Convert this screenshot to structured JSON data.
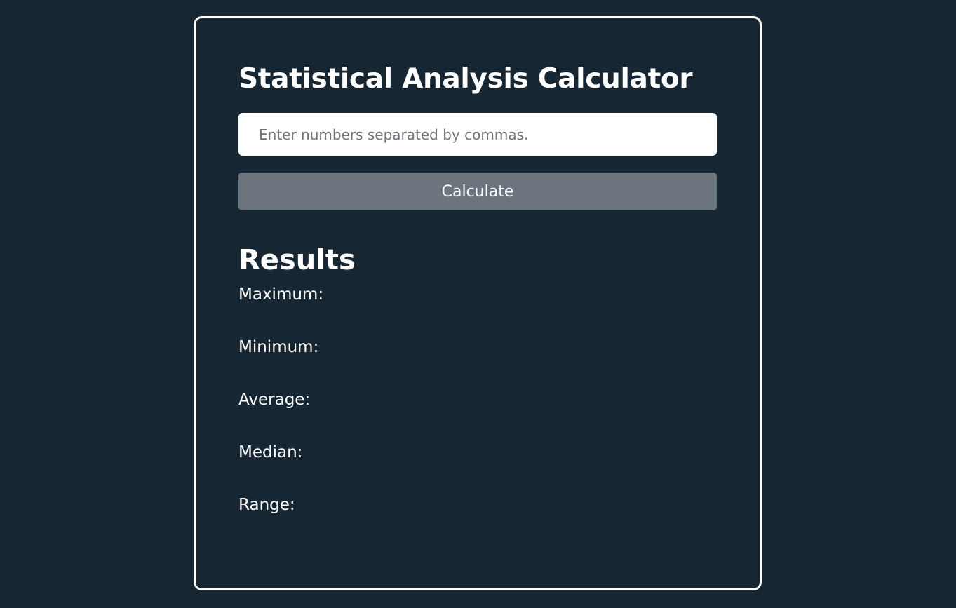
{
  "app": {
    "title": "Statistical Analysis Calculator"
  },
  "input": {
    "value": "",
    "placeholder": "Enter numbers separated by commas."
  },
  "button": {
    "label": "Calculate"
  },
  "results": {
    "heading": "Results",
    "maximum_label": "Maximum:",
    "maximum_value": "",
    "minimum_label": "Minimum:",
    "minimum_value": "",
    "average_label": "Average:",
    "average_value": "",
    "median_label": "Median:",
    "median_value": "",
    "range_label": "Range:",
    "range_value": ""
  },
  "colors": {
    "background": "#162633",
    "card_border": "#ffffff",
    "button": "#6c757d",
    "text": "#ffffff",
    "placeholder": "#6c757d"
  }
}
